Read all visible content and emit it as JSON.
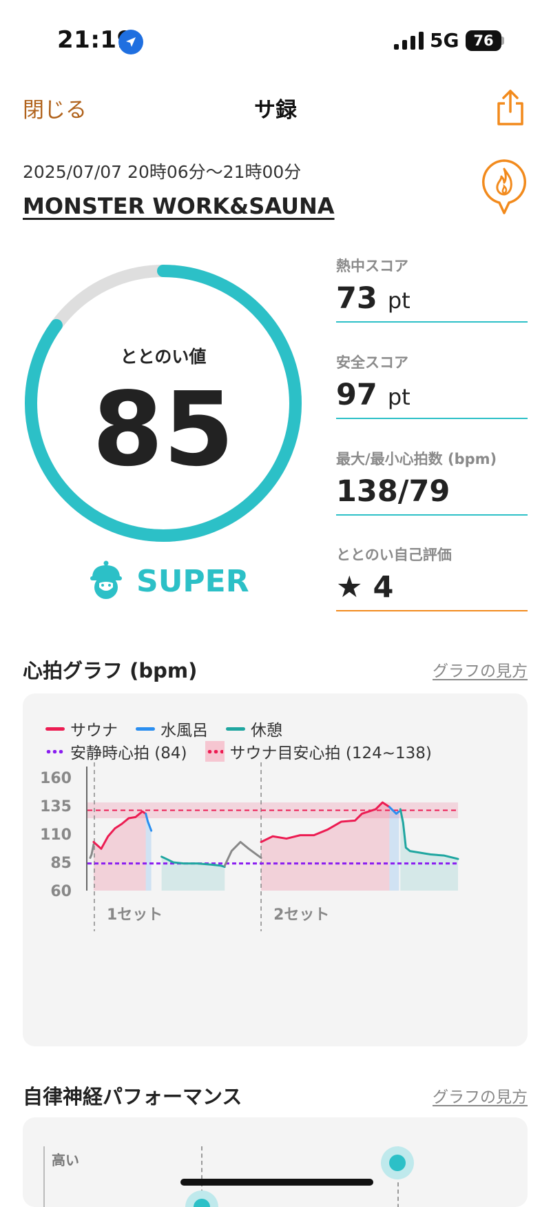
{
  "status_bar": {
    "time": "21:19",
    "network": "5G",
    "battery": "76"
  },
  "nav": {
    "close_label": "閉じる",
    "title": "サ録"
  },
  "session": {
    "datetime": "2025/07/07 20時06分〜21時00分",
    "facility": "MONSTER WORK&SAUNA"
  },
  "gauge": {
    "label": "ととのい値",
    "value": "85",
    "fill_fraction": 0.85,
    "rank": "SUPER"
  },
  "scores": [
    {
      "label": "熱中スコア",
      "value": "73",
      "unit": "pt"
    },
    {
      "label": "安全スコア",
      "value": "97",
      "unit": "pt"
    },
    {
      "label": "最大/最小心拍数 (bpm)",
      "value": "138/79",
      "unit": ""
    },
    {
      "label": "ととのい自己評価",
      "value": "4",
      "unit": "",
      "icon": "star-icon"
    }
  ],
  "heart_graph": {
    "title": "心拍グラフ (bpm)",
    "link": "グラフの見方",
    "legend": {
      "sauna": "サウナ",
      "cold_bath": "水風呂",
      "rest": "休憩",
      "resting_hr": "安静時心拍 (84)",
      "sauna_target": "サウナ目安心拍 (124~138)"
    },
    "set_labels": [
      "1セット",
      "2セット"
    ]
  },
  "autonomic": {
    "title": "自律神経パフォーマンス",
    "link": "グラフの見方",
    "high_label": "高い"
  },
  "colors": {
    "accent": "#2cc0c7",
    "orange": "#f28a1c",
    "sauna": "#ec1c52",
    "cold_bath": "#2a8ef0",
    "rest": "#1fa6a0",
    "resting_hr": "#8a1df0",
    "untracked": "#888888"
  },
  "chart_data": {
    "type": "line",
    "title": "心拍グラフ (bpm)",
    "ylabel": "",
    "xlabel": "",
    "ylim": [
      60,
      160
    ],
    "yticks": [
      160,
      135,
      110,
      85,
      60
    ],
    "x_unit": "minutes from start (estimated)",
    "xlim": [
      0,
      54
    ],
    "reference_lines": [
      {
        "name": "安静時心拍 (84)",
        "y": 84
      },
      {
        "name": "サウナ目安心拍 (124~138)",
        "y": 131,
        "band": [
          124,
          138
        ]
      }
    ],
    "set_markers_x": [
      1,
      25.3
    ],
    "series": [
      {
        "name": "",
        "segment": "untracked",
        "x": [
          0.4,
          0.6,
          0.9
        ],
        "y": [
          89,
          92,
          101
        ]
      },
      {
        "name": "サウナ",
        "segment": "sauna",
        "x": [
          0.9,
          2,
          3,
          4,
          5,
          6,
          7,
          8,
          8.5
        ],
        "y": [
          103,
          97,
          108,
          115,
          119,
          124,
          125,
          130,
          128
        ]
      },
      {
        "name": "水風呂",
        "segment": "cold_bath",
        "x": [
          8.5,
          8.8,
          9.3
        ],
        "y": [
          128,
          121,
          113
        ]
      },
      {
        "name": "休憩",
        "segment": "rest_1",
        "x": [
          10.8,
          11.5,
          12.5,
          14,
          16,
          18,
          19.5,
          20
        ],
        "y": [
          90,
          88,
          85,
          84,
          84,
          83,
          82,
          81
        ]
      },
      {
        "name": "",
        "segment": "untracked",
        "x": [
          20,
          21,
          22.3,
          23.5,
          25.3
        ],
        "y": [
          82,
          95,
          103,
          97,
          89
        ]
      },
      {
        "name": "サウナ",
        "segment": "sauna",
        "x": [
          25.3,
          27,
          29,
          31,
          33,
          35,
          37,
          39,
          40,
          41,
          42,
          43,
          44
        ],
        "y": [
          103,
          108,
          106,
          109,
          109,
          114,
          121,
          122,
          128,
          130,
          132,
          138,
          134
        ]
      },
      {
        "name": "水風呂",
        "segment": "cold_bath",
        "x": [
          44,
          44.5,
          45,
          45.4
        ],
        "y": [
          134,
          131,
          128,
          130
        ]
      },
      {
        "name": "休憩",
        "segment": "rest_2",
        "x": [
          45.6,
          46,
          46.4,
          47,
          48,
          50,
          52,
          54
        ],
        "y": [
          132,
          120,
          98,
          95,
          94,
          92,
          91,
          88
        ]
      }
    ]
  }
}
